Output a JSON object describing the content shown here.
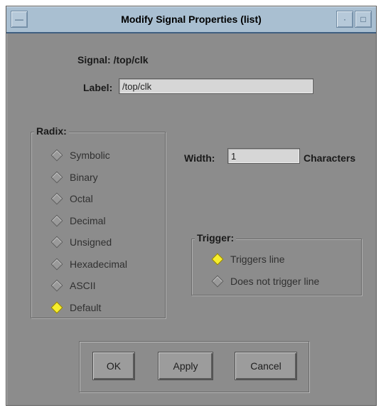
{
  "window": {
    "title": "Modify Signal Properties (list)"
  },
  "signal": {
    "label": "Signal:",
    "value": "/top/clk"
  },
  "label_field": {
    "label": "Label:",
    "value": "/top/clk"
  },
  "radix": {
    "legend": "Radix:",
    "options": [
      "Symbolic",
      "Binary",
      "Octal",
      "Decimal",
      "Unsigned",
      "Hexadecimal",
      "ASCII",
      "Default"
    ],
    "selected": "Default"
  },
  "width": {
    "label": "Width:",
    "value": "1",
    "unit": "Characters"
  },
  "trigger": {
    "legend": "Trigger:",
    "options": [
      "Triggers line",
      "Does not trigger line"
    ],
    "selected": "Triggers line"
  },
  "buttons": {
    "ok": "OK",
    "apply": "Apply",
    "cancel": "Cancel"
  },
  "colors": {
    "dialog_bg": "#8c8c8c",
    "titlebar": "#a9bfd1",
    "radio_selected": "#f6ee2c"
  }
}
